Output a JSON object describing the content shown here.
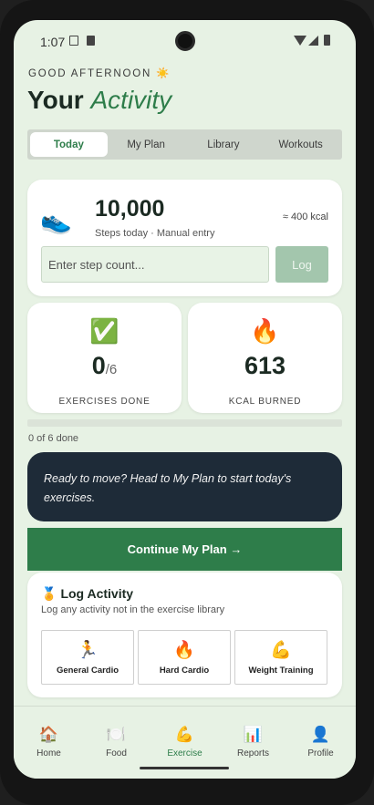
{
  "status_bar": {
    "time": "1:07"
  },
  "header": {
    "greeting": "GOOD AFTERNOON ☀️",
    "title_plain": "Your ",
    "title_accent": "Activity"
  },
  "tabs": [
    {
      "label": "Today",
      "active": true
    },
    {
      "label": "My Plan",
      "active": false
    },
    {
      "label": "Library",
      "active": false
    },
    {
      "label": "Workouts",
      "active": false
    }
  ],
  "steps": {
    "icon": "👟",
    "value": "10,000",
    "subtitle": "Steps today · Manual entry",
    "kcal_estimate": "≈ 400 kcal",
    "input_placeholder": "Enter step count...",
    "log_label": "Log"
  },
  "stats": {
    "exercises": {
      "icon": "✅",
      "value": "0",
      "total": "/6",
      "label": "EXERCISES DONE"
    },
    "kcal": {
      "icon": "🔥",
      "value": "613",
      "label": "KCAL BURNED"
    }
  },
  "progress": {
    "fraction": 0,
    "text": "0 of 6 done"
  },
  "banner": {
    "text": "Ready to move? Head to My Plan to start today's exercises."
  },
  "continue_label": "Continue My Plan →",
  "log_activity": {
    "icon": "🏅",
    "title": "Log Activity",
    "subtitle": "Log any activity not in the exercise library",
    "options": [
      {
        "icon": "🏃",
        "label": "General Cardio"
      },
      {
        "icon": "🔥",
        "label": "Hard Cardio"
      },
      {
        "icon": "💪",
        "label": "Weight Training"
      }
    ]
  },
  "bottom_nav": [
    {
      "icon": "🏠",
      "label": "Home",
      "active": false
    },
    {
      "icon": "🍽️",
      "label": "Food",
      "active": false
    },
    {
      "icon": "💪",
      "label": "Exercise",
      "active": true
    },
    {
      "icon": "📊",
      "label": "Reports",
      "active": false
    },
    {
      "icon": "👤",
      "label": "Profile",
      "active": false
    }
  ],
  "colors": {
    "accent": "#2e7d4a",
    "background": "#e7f2e4",
    "banner": "#1e2b38"
  }
}
